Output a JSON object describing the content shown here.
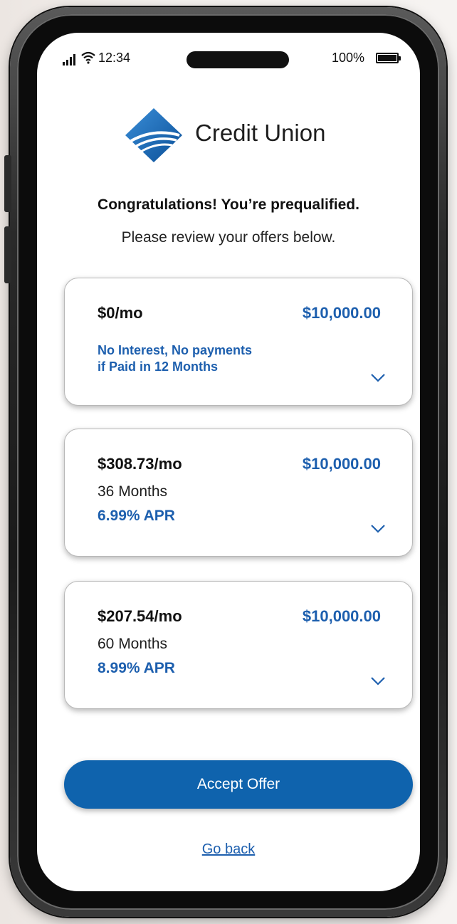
{
  "status_bar": {
    "time": "12:34",
    "battery_percent": "100%",
    "icons": [
      "signal-icon",
      "wifi-icon",
      "battery-icon"
    ]
  },
  "brand": {
    "name": "Credit Union",
    "logo_icon": "credit-union-logo",
    "colors": {
      "primary": "#0f63ad",
      "accent": "#1d5fae"
    }
  },
  "heading": {
    "title": "Congratulations! You’re prequalified.",
    "subtitle": "Please review your offers below."
  },
  "offers": [
    {
      "monthly": "$0/mo",
      "amount": "$10,000.00",
      "promo_line1": "No Interest, No payments",
      "promo_line2": "if Paid in 12 Months"
    },
    {
      "monthly": "$308.73/mo",
      "amount": "$10,000.00",
      "term": "36 Months",
      "apr": "6.99% APR"
    },
    {
      "monthly": "$207.54/mo",
      "amount": "$10,000.00",
      "term": "60 Months",
      "apr": "8.99% APR"
    }
  ],
  "actions": {
    "accept_label": "Accept Offer",
    "back_label": "Go back"
  }
}
